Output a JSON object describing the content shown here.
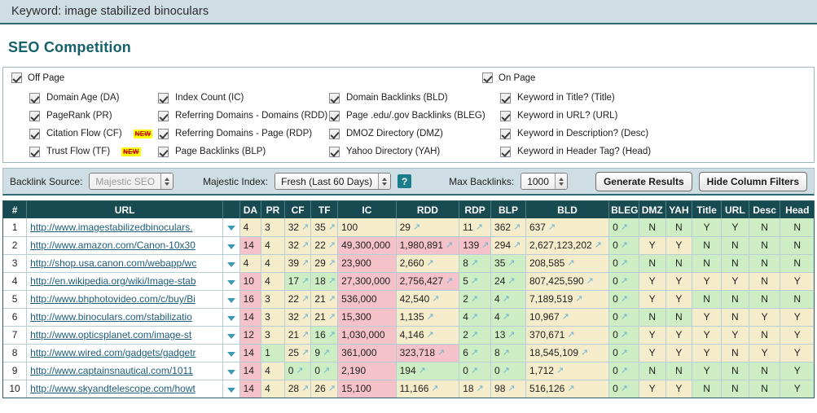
{
  "keyword_bar": {
    "text": "Keyword: image stabilized binoculars"
  },
  "page_title": "SEO Competition",
  "filters": {
    "off_page": {
      "label": "Off Page",
      "checked": true
    },
    "on_page": {
      "label": "On Page",
      "checked": true
    },
    "column_1": [
      {
        "label": "Domain Age (DA)",
        "checked": true,
        "badge": ""
      },
      {
        "label": "PageRank (PR)",
        "checked": true,
        "badge": ""
      },
      {
        "label": "Citation Flow (CF)",
        "checked": true,
        "badge": "NEW"
      },
      {
        "label": "Trust Flow (TF)",
        "checked": true,
        "badge": "NEW"
      }
    ],
    "column_2": [
      {
        "label": "Index Count (IC)",
        "checked": true,
        "badge": ""
      },
      {
        "label": "Referring Domains - Domains (RDD)",
        "checked": true,
        "badge": ""
      },
      {
        "label": "Referring Domains - Page (RDP)",
        "checked": true,
        "badge": ""
      },
      {
        "label": "Page Backlinks (BLP)",
        "checked": true,
        "badge": ""
      }
    ],
    "column_3": [
      {
        "label": "Domain Backlinks (BLD)",
        "checked": true,
        "badge": ""
      },
      {
        "label": "Page .edu/.gov Backlinks (BLEG)",
        "checked": true,
        "badge": ""
      },
      {
        "label": "DMOZ Directory (DMZ)",
        "checked": true,
        "badge": ""
      },
      {
        "label": "Yahoo Directory (YAH)",
        "checked": true,
        "badge": ""
      }
    ],
    "column_4": [
      {
        "label": "Keyword in Title? (Title)",
        "checked": true,
        "badge": ""
      },
      {
        "label": "Keyword in URL? (URL)",
        "checked": true,
        "badge": ""
      },
      {
        "label": "Keyword in Description? (Desc)",
        "checked": true,
        "badge": ""
      },
      {
        "label": "Keyword in Header Tag? (Head)",
        "checked": true,
        "badge": ""
      }
    ]
  },
  "toolbar": {
    "backlink_source_label": "Backlink Source:",
    "backlink_source_value": "Majestic SEO",
    "majestic_index_label": "Majestic Index:",
    "majestic_index_value": "Fresh (Last 60 Days)",
    "help_label": "?",
    "max_backlinks_label": "Max Backlinks:",
    "max_backlinks_value": "1000",
    "generate_results_label": "Generate Results",
    "hide_column_filters_label": "Hide Column Filters"
  },
  "table": {
    "headers": [
      "#",
      "URL",
      "",
      "DA",
      "PR",
      "CF",
      "TF",
      "IC",
      "RDD",
      "RDP",
      "BLP",
      "BLD",
      "BLEG",
      "DMZ",
      "YAH",
      "Title",
      "URL",
      "Desc",
      "Head"
    ],
    "rows": [
      {
        "idx": "1",
        "url": "http://www.imagestabilizedbinoculars.",
        "da": "4",
        "da_bg": "bg-tan",
        "pr": "3",
        "pr_bg": "bg-tan",
        "cf": "32",
        "cf_bg": "bg-tan",
        "tf": "35",
        "tf_bg": "bg-tan",
        "ic": "100",
        "ic_bg": "bg-tan",
        "rdd": "29",
        "rdd_bg": "bg-tan",
        "rdp": "11",
        "rdp_bg": "bg-tan",
        "blp": "362",
        "blp_bg": "bg-tan",
        "bld": "637",
        "bld_bg": "bg-tan",
        "bleg": "0",
        "bleg_bg": "bg-green",
        "dmz": "N",
        "dmz_bg": "bg-green",
        "yah": "N",
        "yah_bg": "bg-green",
        "title": "Y",
        "title_bg": "bg-green",
        "urlk": "Y",
        "urlk_bg": "bg-green",
        "desc": "N",
        "desc_bg": "bg-green",
        "head": "N",
        "head_bg": "bg-green"
      },
      {
        "idx": "2",
        "url": "http://www.amazon.com/Canon-10x30",
        "da": "14",
        "da_bg": "bg-pink",
        "pr": "4",
        "pr_bg": "bg-tan",
        "cf": "32",
        "cf_bg": "bg-tan",
        "tf": "22",
        "tf_bg": "bg-tan",
        "ic": "49,300,000",
        "ic_bg": "bg-pink",
        "rdd": "1,980,891",
        "rdd_bg": "bg-pink",
        "rdp": "139",
        "rdp_bg": "bg-pink",
        "blp": "294",
        "blp_bg": "bg-tan",
        "bld": "2,627,123,202",
        "bld_bg": "bg-tan",
        "bleg": "0",
        "bleg_bg": "bg-green",
        "dmz": "Y",
        "dmz_bg": "bg-tan",
        "yah": "Y",
        "yah_bg": "bg-tan",
        "title": "N",
        "title_bg": "bg-green",
        "urlk": "N",
        "urlk_bg": "bg-green",
        "desc": "N",
        "desc_bg": "bg-green",
        "head": "N",
        "head_bg": "bg-green"
      },
      {
        "idx": "3",
        "url": "http://shop.usa.canon.com/webapp/wc",
        "da": "4",
        "da_bg": "bg-tan",
        "pr": "4",
        "pr_bg": "bg-tan",
        "cf": "39",
        "cf_bg": "bg-tan",
        "tf": "29",
        "tf_bg": "bg-tan",
        "ic": "23,900",
        "ic_bg": "bg-pink",
        "rdd": "2,660",
        "rdd_bg": "bg-tan",
        "rdp": "8",
        "rdp_bg": "bg-green",
        "blp": "35",
        "blp_bg": "bg-green",
        "bld": "208,585",
        "bld_bg": "bg-tan",
        "bleg": "0",
        "bleg_bg": "bg-green",
        "dmz": "N",
        "dmz_bg": "bg-green",
        "yah": "N",
        "yah_bg": "bg-green",
        "title": "N",
        "title_bg": "bg-green",
        "urlk": "N",
        "urlk_bg": "bg-green",
        "desc": "N",
        "desc_bg": "bg-green",
        "head": "N",
        "head_bg": "bg-green"
      },
      {
        "idx": "4",
        "url": "http://en.wikipedia.org/wiki/Image-stab",
        "da": "10",
        "da_bg": "bg-pink",
        "pr": "4",
        "pr_bg": "bg-tan",
        "cf": "17",
        "cf_bg": "bg-green",
        "tf": "18",
        "tf_bg": "bg-green",
        "ic": "27,300,000",
        "ic_bg": "bg-pink",
        "rdd": "2,756,427",
        "rdd_bg": "bg-pink",
        "rdp": "5",
        "rdp_bg": "bg-green",
        "blp": "24",
        "blp_bg": "bg-green",
        "bld": "807,425,590",
        "bld_bg": "bg-tan",
        "bleg": "0",
        "bleg_bg": "bg-green",
        "dmz": "Y",
        "dmz_bg": "bg-tan",
        "yah": "Y",
        "yah_bg": "bg-tan",
        "title": "Y",
        "title_bg": "bg-tan",
        "urlk": "Y",
        "urlk_bg": "bg-tan",
        "desc": "N",
        "desc_bg": "bg-tan",
        "head": "Y",
        "head_bg": "bg-tan"
      },
      {
        "idx": "5",
        "url": "http://www.bhphotovideo.com/c/buy/Bi",
        "da": "16",
        "da_bg": "bg-pink",
        "pr": "3",
        "pr_bg": "bg-tan",
        "cf": "22",
        "cf_bg": "bg-tan",
        "tf": "21",
        "tf_bg": "bg-tan",
        "ic": "536,000",
        "ic_bg": "bg-pink",
        "rdd": "42,540",
        "rdd_bg": "bg-tan",
        "rdp": "2",
        "rdp_bg": "bg-green",
        "blp": "4",
        "blp_bg": "bg-green",
        "bld": "7,189,519",
        "bld_bg": "bg-tan",
        "bleg": "0",
        "bleg_bg": "bg-green",
        "dmz": "Y",
        "dmz_bg": "bg-tan",
        "yah": "Y",
        "yah_bg": "bg-tan",
        "title": "N",
        "title_bg": "bg-green",
        "urlk": "N",
        "urlk_bg": "bg-green",
        "desc": "N",
        "desc_bg": "bg-green",
        "head": "N",
        "head_bg": "bg-green"
      },
      {
        "idx": "6",
        "url": "http://www.binoculars.com/stabilizatio",
        "da": "14",
        "da_bg": "bg-pink",
        "pr": "3",
        "pr_bg": "bg-tan",
        "cf": "32",
        "cf_bg": "bg-tan",
        "tf": "21",
        "tf_bg": "bg-tan",
        "ic": "15,300",
        "ic_bg": "bg-pink",
        "rdd": "1,135",
        "rdd_bg": "bg-tan",
        "rdp": "4",
        "rdp_bg": "bg-green",
        "blp": "4",
        "blp_bg": "bg-green",
        "bld": "10,967",
        "bld_bg": "bg-tan",
        "bleg": "0",
        "bleg_bg": "bg-green",
        "dmz": "N",
        "dmz_bg": "bg-green",
        "yah": "N",
        "yah_bg": "bg-green",
        "title": "Y",
        "title_bg": "bg-tan",
        "urlk": "N",
        "urlk_bg": "bg-tan",
        "desc": "Y",
        "desc_bg": "bg-tan",
        "head": "Y",
        "head_bg": "bg-tan"
      },
      {
        "idx": "7",
        "url": "http://www.opticsplanet.com/image-st",
        "da": "12",
        "da_bg": "bg-pink",
        "pr": "3",
        "pr_bg": "bg-tan",
        "cf": "21",
        "cf_bg": "bg-tan",
        "tf": "16",
        "tf_bg": "bg-green",
        "ic": "1,030,000",
        "ic_bg": "bg-pink",
        "rdd": "4,146",
        "rdd_bg": "bg-tan",
        "rdp": "2",
        "rdp_bg": "bg-green",
        "blp": "13",
        "blp_bg": "bg-green",
        "bld": "370,671",
        "bld_bg": "bg-tan",
        "bleg": "0",
        "bleg_bg": "bg-green",
        "dmz": "Y",
        "dmz_bg": "bg-tan",
        "yah": "Y",
        "yah_bg": "bg-tan",
        "title": "Y",
        "title_bg": "bg-tan",
        "urlk": "Y",
        "urlk_bg": "bg-tan",
        "desc": "N",
        "desc_bg": "bg-tan",
        "head": "Y",
        "head_bg": "bg-tan"
      },
      {
        "idx": "8",
        "url": "http://www.wired.com/gadgets/gadgetr",
        "da": "14",
        "da_bg": "bg-pink",
        "pr": "1",
        "pr_bg": "bg-green",
        "cf": "25",
        "cf_bg": "bg-tan",
        "tf": "9",
        "tf_bg": "bg-green",
        "ic": "361,000",
        "ic_bg": "bg-pink",
        "rdd": "323,718",
        "rdd_bg": "bg-pink",
        "rdp": "6",
        "rdp_bg": "bg-green",
        "blp": "8",
        "blp_bg": "bg-green",
        "bld": "18,545,109",
        "bld_bg": "bg-tan",
        "bleg": "0",
        "bleg_bg": "bg-green",
        "dmz": "Y",
        "dmz_bg": "bg-tan",
        "yah": "Y",
        "yah_bg": "bg-tan",
        "title": "Y",
        "title_bg": "bg-tan",
        "urlk": "N",
        "urlk_bg": "bg-tan",
        "desc": "Y",
        "desc_bg": "bg-tan",
        "head": "Y",
        "head_bg": "bg-tan"
      },
      {
        "idx": "9",
        "url": "http://www.captainsnautical.com/1011",
        "da": "14",
        "da_bg": "bg-pink",
        "pr": "4",
        "pr_bg": "bg-tan",
        "cf": "0",
        "cf_bg": "bg-green",
        "tf": "0",
        "tf_bg": "bg-green",
        "ic": "2,190",
        "ic_bg": "bg-pink",
        "rdd": "194",
        "rdd_bg": "bg-green",
        "rdp": "0",
        "rdp_bg": "bg-green",
        "blp": "0",
        "blp_bg": "bg-green",
        "bld": "1,712",
        "bld_bg": "bg-tan",
        "bleg": "0",
        "bleg_bg": "bg-green",
        "dmz": "N",
        "dmz_bg": "bg-green",
        "yah": "N",
        "yah_bg": "bg-green",
        "title": "Y",
        "title_bg": "bg-green",
        "urlk": "N",
        "urlk_bg": "bg-green",
        "desc": "N",
        "desc_bg": "bg-green",
        "head": "Y",
        "head_bg": "bg-green"
      },
      {
        "idx": "10",
        "url": "http://www.skyandtelescope.com/howt",
        "da": "14",
        "da_bg": "bg-pink",
        "pr": "4",
        "pr_bg": "bg-tan",
        "cf": "28",
        "cf_bg": "bg-tan",
        "tf": "26",
        "tf_bg": "bg-tan",
        "ic": "15,100",
        "ic_bg": "bg-pink",
        "rdd": "11,166",
        "rdd_bg": "bg-tan",
        "rdp": "18",
        "rdp_bg": "bg-tan",
        "blp": "98",
        "blp_bg": "bg-tan",
        "bld": "516,126",
        "bld_bg": "bg-tan",
        "bleg": "0",
        "bleg_bg": "bg-green",
        "dmz": "Y",
        "dmz_bg": "bg-tan",
        "yah": "Y",
        "yah_bg": "bg-tan",
        "title": "N",
        "title_bg": "bg-green",
        "urlk": "N",
        "urlk_bg": "bg-green",
        "desc": "N",
        "desc_bg": "bg-green",
        "head": "Y",
        "head_bg": "bg-green"
      }
    ]
  },
  "icons": {
    "caret": "chevron-down-icon",
    "trend_arrow": "↗"
  }
}
